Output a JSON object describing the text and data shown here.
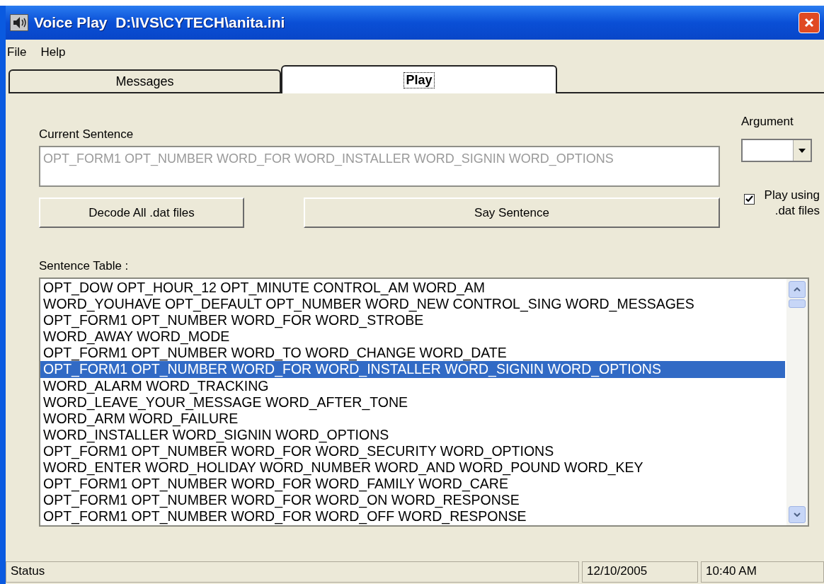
{
  "window": {
    "title": "Voice Play  D:\\IVS\\CYTECH\\anita.ini"
  },
  "menu": [
    "File",
    "Help"
  ],
  "tabs": [
    {
      "label": "Messages",
      "selected": false
    },
    {
      "label": "Play",
      "selected": true
    }
  ],
  "current_sentence": {
    "label": "Current Sentence",
    "value": "OPT_FORM1 OPT_NUMBER WORD_FOR WORD_INSTALLER WORD_SIGNIN WORD_OPTIONS",
    "disabled": true
  },
  "argument": {
    "label": "Argument"
  },
  "buttons": [
    "Decode All .dat files",
    "Say Sentence"
  ],
  "play_using_dat": {
    "label": "Play using .dat files",
    "checked": true
  },
  "sentence_table": {
    "label": "Sentence Table :",
    "rows": [
      {
        "text": "OPT_DOW OPT_HOUR_12 OPT_MINUTE CONTROL_AM WORD_AM",
        "selected": false
      },
      {
        "text": "WORD_YOUHAVE OPT_DEFAULT OPT_NUMBER WORD_NEW CONTROL_SING WORD_MESSAGES",
        "selected": false
      },
      {
        "text": "OPT_FORM1 OPT_NUMBER WORD_FOR WORD_STROBE",
        "selected": false
      },
      {
        "text": "WORD_AWAY WORD_MODE",
        "selected": false
      },
      {
        "text": "OPT_FORM1 OPT_NUMBER WORD_TO WORD_CHANGE WORD_DATE",
        "selected": false
      },
      {
        "text": "OPT_FORM1 OPT_NUMBER WORD_FOR WORD_INSTALLER WORD_SIGNIN WORD_OPTIONS",
        "selected": true
      },
      {
        "text": "WORD_ALARM WORD_TRACKING",
        "selected": false
      },
      {
        "text": "WORD_LEAVE_YOUR_MESSAGE WORD_AFTER_TONE",
        "selected": false
      },
      {
        "text": "WORD_ARM WORD_FAILURE",
        "selected": false
      },
      {
        "text": "WORD_INSTALLER WORD_SIGNIN WORD_OPTIONS",
        "selected": false
      },
      {
        "text": "OPT_FORM1 OPT_NUMBER WORD_FOR WORD_SECURITY WORD_OPTIONS",
        "selected": false
      },
      {
        "text": "WORD_ENTER WORD_HOLIDAY WORD_NUMBER WORD_AND WORD_POUND WORD_KEY",
        "selected": false
      },
      {
        "text": "OPT_FORM1 OPT_NUMBER WORD_FOR WORD_FAMILY WORD_CARE",
        "selected": false
      },
      {
        "text": "OPT_FORM1 OPT_NUMBER WORD_FOR WORD_ON WORD_RESPONSE",
        "selected": false
      },
      {
        "text": "OPT_FORM1 OPT_NUMBER WORD_FOR WORD_OFF WORD_RESPONSE",
        "selected": false
      }
    ]
  },
  "status_bar": [
    "Status",
    "12/10/2005",
    "10:40 AM"
  ]
}
